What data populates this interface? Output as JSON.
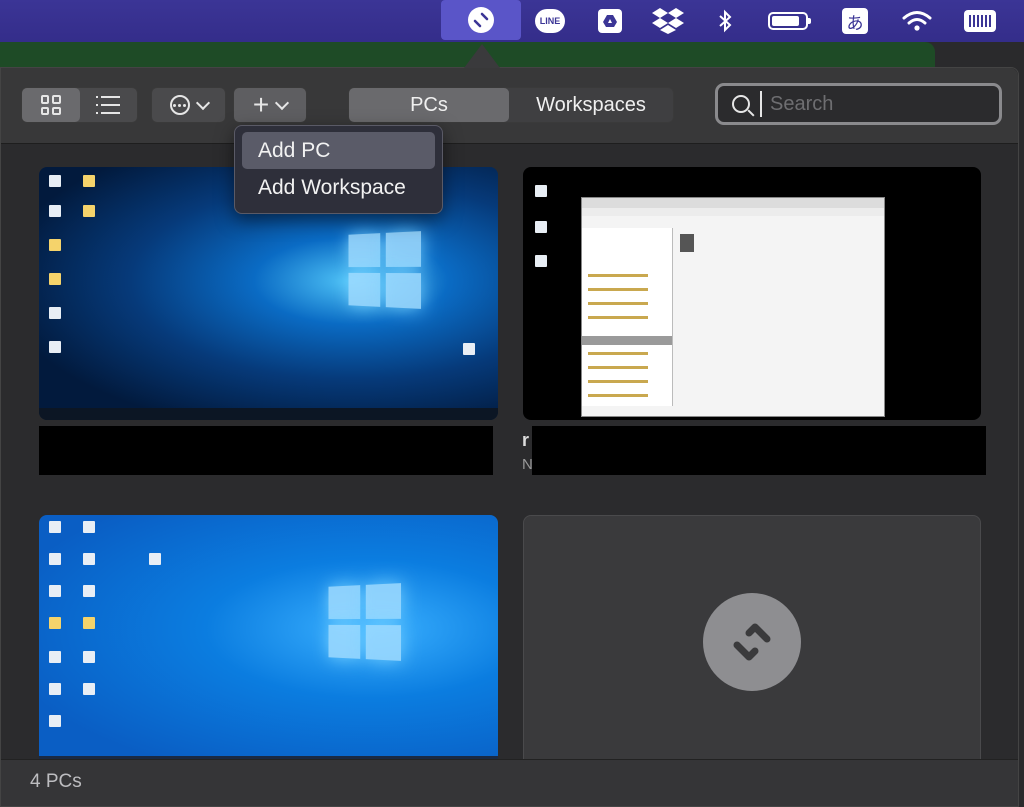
{
  "menubar": {
    "icons": [
      "remote-desktop-icon",
      "line-icon",
      "google-drive-icon",
      "dropbox-icon",
      "bluetooth-icon",
      "battery-icon",
      "input-method-icon",
      "wifi-icon",
      "keyboard-icon"
    ],
    "line_label": "LINE",
    "ime_label": "あ",
    "battery_level": 0.85
  },
  "toolbar": {
    "view_options": [
      "grid",
      "list"
    ],
    "selected_view": "grid",
    "tabs": [
      {
        "label": "PCs",
        "selected": true
      },
      {
        "label": "Workspaces",
        "selected": false
      }
    ],
    "search": {
      "placeholder": "Search",
      "value": ""
    }
  },
  "add_menu": {
    "items": [
      {
        "label": "Add PC",
        "highlighted": true
      },
      {
        "label": "Add Workspace",
        "highlighted": false
      }
    ]
  },
  "cards": [
    {
      "kind": "windows-desktop"
    },
    {
      "kind": "raspberry-pi-desktop",
      "peek_title": "r",
      "peek_sub": "N"
    },
    {
      "kind": "windows-desktop"
    },
    {
      "kind": "placeholder",
      "icon": "remote-desktop-icon"
    }
  ],
  "status": {
    "count_text": "4 PCs"
  },
  "colors": {
    "menubar": "#3b3596",
    "popover_bg": "#2b2b2d",
    "toolbar_bg": "#383839",
    "accent_tab": "#6a6a6d"
  }
}
